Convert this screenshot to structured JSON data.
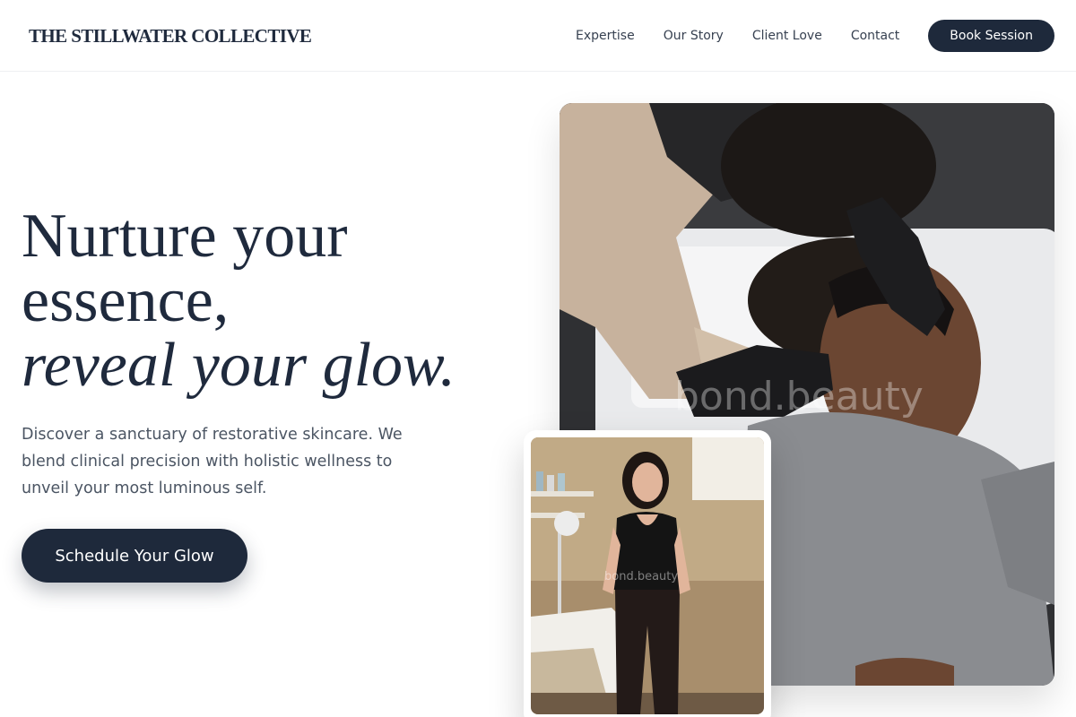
{
  "nav": {
    "brand": "THE STILLWATER COLLECTIVE",
    "links": [
      "Expertise",
      "Our Story",
      "Client Love",
      "Contact"
    ],
    "book_label": "Book Session"
  },
  "hero": {
    "title_line1": "Nurture your",
    "title_line2": "essence,",
    "title_line3": "reveal your glow.",
    "description": "Discover a sanctuary of restorative skincare. We blend clinical precision with holistic wellness to unveil your most luminous self.",
    "cta_label": "Schedule Your Glow"
  },
  "images": {
    "main_watermark": "bond.beauty",
    "inset_watermark": "bond.beauty"
  },
  "colors": {
    "primary": "#1e293b",
    "heading": "#1f2a3d",
    "body_text": "#4b5563"
  }
}
